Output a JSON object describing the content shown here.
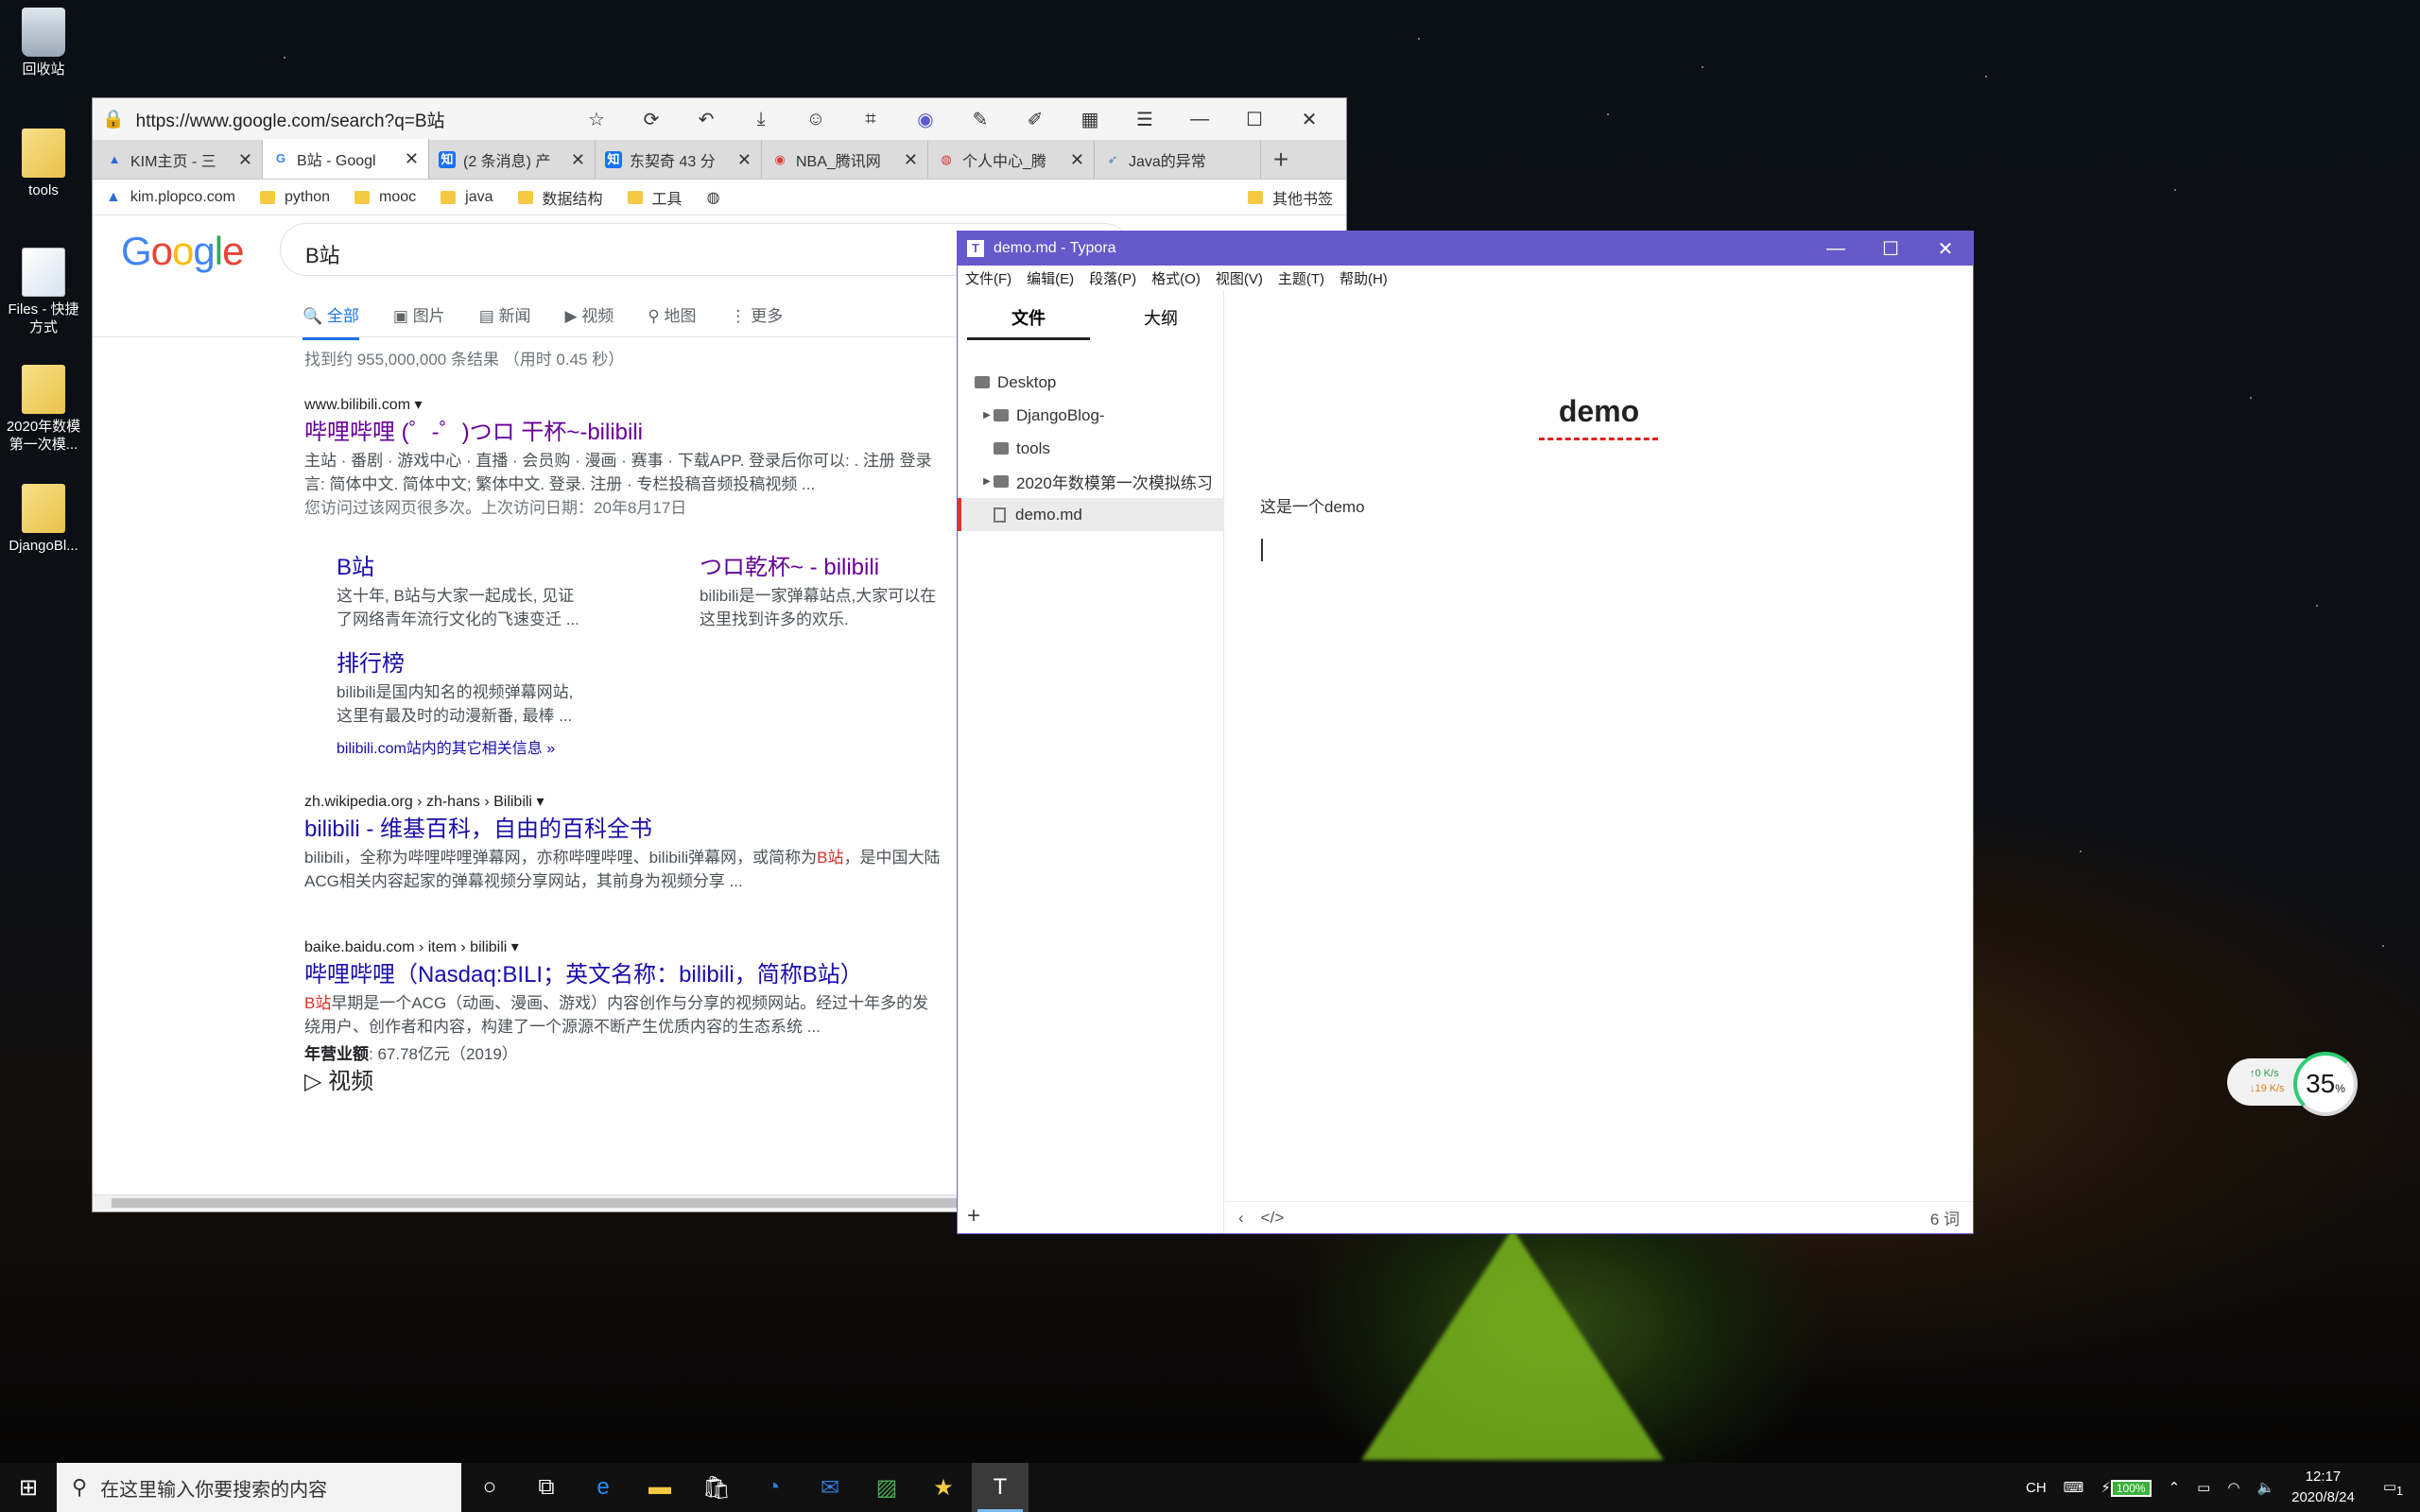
{
  "desktop": {
    "icons": [
      {
        "label": "回收站",
        "type": "bin"
      },
      {
        "label": "tools",
        "type": "folder"
      },
      {
        "label": "Files - 快捷方式",
        "type": "doc"
      },
      {
        "label": "2020年数模第一次模...",
        "type": "folder"
      },
      {
        "label": "DjangoBl...",
        "type": "folder"
      }
    ]
  },
  "browser": {
    "url": "https://www.google.com/search?q=B站",
    "tabs": [
      {
        "label": "KIM主页 - 三",
        "icon": "kim-icon",
        "color": "#2a6cd6"
      },
      {
        "label": "B站 - Googl",
        "icon": "google-icon",
        "color": "#ffffff"
      },
      {
        "label": "(2 条消息) 产",
        "icon": "zhihu-icon",
        "color": "#1772f6"
      },
      {
        "label": "东契奇 43 分",
        "icon": "zhihu-icon",
        "color": "#1772f6"
      },
      {
        "label": "NBA_腾讯网",
        "icon": "chrome-icon",
        "color": "#db4437"
      },
      {
        "label": "个人中心_腾",
        "icon": "user-icon",
        "color": "#d33"
      },
      {
        "label": "Java的异常",
        "icon": "rocket-icon",
        "color": "#3a7bd5"
      }
    ],
    "bookmarks": [
      "kim.plopco.com",
      "python",
      "mooc",
      "java",
      "数据结构",
      "工具"
    ],
    "other_bookmarks": "其他书签",
    "google": {
      "query": "B站",
      "nav": [
        "全部",
        "图片",
        "新闻",
        "视频",
        "地图",
        "更多"
      ],
      "stats": "找到约 955,000,000 条结果 （用时 0.45 秒）",
      "r1": {
        "cite": "www.bilibili.com",
        "title": "哔哩哔哩 (゜-゜)つロ 干杯~-bilibili",
        "snippet1": "主站 · 番剧 · 游戏中心 · 直播 · 会员购 · 漫画 · 赛事 · 下载APP. 登录后你可以: . 注册 登录",
        "snippet2": "言: 简体中文. 简体中文; 繁体中文. 登录. 注册 · 专栏投稿音频投稿视频 ...",
        "visited": "您访问过该网页很多次。上次访问日期：20年8月17日"
      },
      "sitelinks": [
        {
          "title": "B站",
          "line1": "这十年, B站与大家一起成长, 见证",
          "line2": "了网络青年流行文化的飞速变迁 ..."
        },
        {
          "title": "つロ乾杯~ - bilibili",
          "line1": "bilibili是一家弹幕站点,大家可以在",
          "line2": "这里找到许多的欢乐."
        },
        {
          "title": "排行榜",
          "line1": "bilibili是国内知名的视频弹幕网站,",
          "line2": "这里有最及时的动漫新番, 最棒 ..."
        }
      ],
      "more_link": "bilibili.com站内的其它相关信息 »",
      "r2": {
        "cite": "zh.wikipedia.org › zh-hans › Bilibili",
        "title": "bilibili - 维基百科，自由的百科全书",
        "s1a": "bilibili，全称为哔哩哔哩弹幕网，亦称哔哩哔哩、bilibili弹幕网，或简称为",
        "s1b": "B站",
        "s1c": "，是中国大陆",
        "s2": "ACG相关内容起家的弹幕视频分享网站，其前身为视频分享 ..."
      },
      "r3": {
        "cite": "baike.baidu.com › item › bilibili",
        "title": "哔哩哔哩（Nasdaq:BILI；英文名称：bilibili，简称B站）",
        "s1a": "B站",
        "s1b": "早期是一个ACG（动画、漫画、游戏）内容创作与分享的视频网站。经过十年多的发",
        "s2": "绕用户、创作者和内容，构建了一个源源不断产生优质内容的生态系统 ...",
        "rev_label": "年营业额",
        "rev_value": ": 67.78亿元（2019）"
      },
      "videos_heading": "视频"
    }
  },
  "typora": {
    "title": "demo.md - Typora",
    "menu": [
      "文件(F)",
      "编辑(E)",
      "段落(P)",
      "格式(O)",
      "视图(V)",
      "主题(T)",
      "帮助(H)"
    ],
    "side_tabs": [
      "文件",
      "大纲"
    ],
    "tree": [
      "Desktop",
      "DjangoBlog-",
      "tools",
      "2020年数模第一次模拟练习",
      "demo.md"
    ],
    "heading": "demo",
    "paragraph": "这是一个demo",
    "word_count": "6 词"
  },
  "net": {
    "up": "↑0 K/s",
    "down": "↓19 K/s",
    "cpu": "35",
    "unit": "%"
  },
  "taskbar": {
    "search": "在这里输入你要搜索的内容",
    "ime": "CH",
    "battery": "100%",
    "time": "12:17",
    "date": "2020/8/24",
    "notifications": "1"
  }
}
